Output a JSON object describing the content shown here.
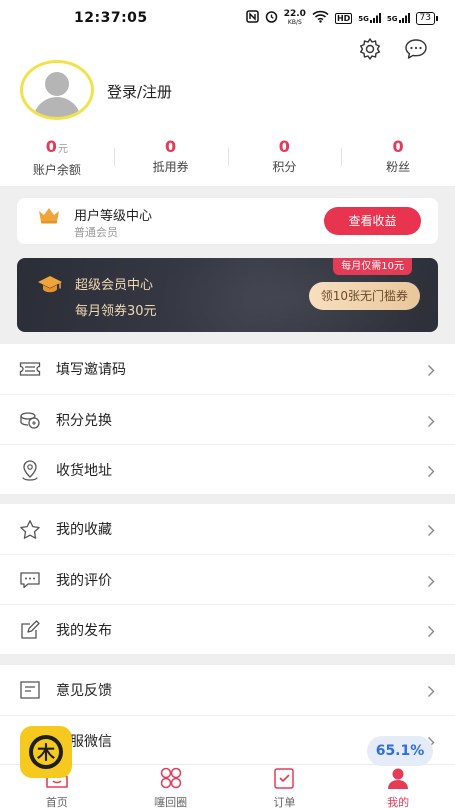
{
  "status_bar": {
    "time": "12:37:05",
    "net_speed_value": "22.0",
    "net_speed_unit": "KB/S",
    "hd_label": "HD",
    "signal1": "5G",
    "signal2": "5G",
    "battery": "73"
  },
  "profile": {
    "login_text": "登录/注册",
    "stats": [
      {
        "value": "0",
        "unit": "元",
        "label": "账户余额"
      },
      {
        "value": "0",
        "unit": "",
        "label": "抵用券"
      },
      {
        "value": "0",
        "unit": "",
        "label": "积分"
      },
      {
        "value": "0",
        "unit": "",
        "label": "粉丝"
      }
    ]
  },
  "level_card": {
    "title": "用户等级中心",
    "subtitle": "普通会员",
    "button": "查看收益"
  },
  "vip_card": {
    "title": "超级会员中心",
    "subtitle": "每月领券30元",
    "tag": "每月仅需10元",
    "button": "领10张无门槛券"
  },
  "menu_groups": [
    [
      {
        "label": "填写邀请码",
        "icon": "ticket-icon"
      },
      {
        "label": "积分兑换",
        "icon": "coin-exchange-icon"
      },
      {
        "label": "收货地址",
        "icon": "location-pin-icon"
      }
    ],
    [
      {
        "label": "我的收藏",
        "icon": "star-icon"
      },
      {
        "label": "我的评价",
        "icon": "comment-icon"
      },
      {
        "label": "我的发布",
        "icon": "edit-icon"
      }
    ],
    [
      {
        "label": "意见反馈",
        "icon": "feedback-icon"
      },
      {
        "label": "客服微信",
        "icon": "wechat-service-icon"
      }
    ]
  ],
  "tabbar": {
    "tabs": [
      {
        "label": "首页",
        "icon": "home-icon",
        "active": false
      },
      {
        "label": "噻回圈",
        "icon": "grid-circles-icon",
        "active": false
      },
      {
        "label": "订单",
        "icon": "order-icon",
        "active": false
      },
      {
        "label": "我的",
        "icon": "user-icon",
        "active": true
      }
    ]
  },
  "overlay": {
    "badge_char": "木",
    "percent": "65.1%"
  },
  "colors": {
    "accent": "#e53b56",
    "vip_gold": "#f1d9b2",
    "avatar_ring": "#f2e24a"
  }
}
